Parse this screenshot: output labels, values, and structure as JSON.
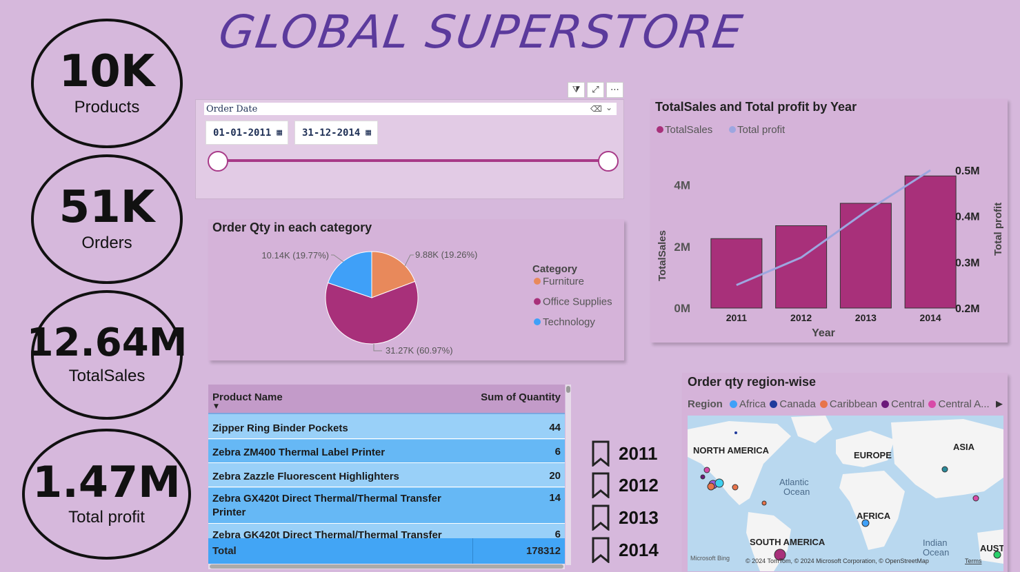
{
  "title": "GLOBAL SUPERSTORE",
  "kpis": [
    {
      "value": "10K",
      "label": "Products"
    },
    {
      "value": "51K",
      "label": "Orders"
    },
    {
      "value": "12.64M",
      "label": "TotalSales"
    },
    {
      "value": "1.47M",
      "label": "Total profit"
    }
  ],
  "slicer": {
    "label": "Order Date",
    "start_date": "01-01-2011",
    "end_date": "31-12-2014",
    "range_fraction": [
      0,
      1
    ]
  },
  "pie": {
    "title": "Order Qty in each category",
    "legend_title": "Category",
    "chart_data": {
      "type": "pie",
      "categories": [
        "Furniture",
        "Office Supplies",
        "Technology"
      ],
      "values": [
        9.88,
        31.27,
        10.14
      ],
      "labels": [
        "9.88K (19.26%)",
        "31.27K (60.97%)",
        "10.14K (19.77%)"
      ],
      "colors": [
        "#e8895b",
        "#a8307a",
        "#3fa0f8"
      ]
    }
  },
  "combo": {
    "title": "TotalSales and Total profit by Year",
    "chart_data": {
      "type": "bar",
      "categories": [
        "2011",
        "2012",
        "2013",
        "2014"
      ],
      "series": [
        {
          "name": "TotalSales",
          "values": [
            2.26,
            2.68,
            3.41,
            4.3
          ],
          "color": "#a8307a",
          "axis": "left"
        },
        {
          "name": "Total profit",
          "values": [
            0.25,
            0.31,
            0.41,
            0.5
          ],
          "color": "#9da6e0",
          "axis": "right",
          "type": "line"
        }
      ],
      "xlabel": "Year",
      "ylabel": "TotalSales",
      "y2label": "Total profit",
      "left_ticks": [
        "0M",
        "2M",
        "4M"
      ],
      "left_range": [
        0,
        4.8
      ],
      "right_ticks": [
        "0.2M",
        "0.3M",
        "0.4M",
        "0.5M"
      ],
      "right_range": [
        0.2,
        0.5
      ]
    }
  },
  "table": {
    "headers": [
      "Product Name",
      "Sum of Quantity"
    ],
    "rows": [
      {
        "name": "Zipper Ring Binder Pockets",
        "qty": "44"
      },
      {
        "name": "Zebra ZM400 Thermal Label Printer",
        "qty": "6"
      },
      {
        "name": "Zebra Zazzle Fluorescent Highlighters",
        "qty": "20"
      },
      {
        "name": "Zebra GX420t Direct Thermal/Thermal Transfer Printer",
        "qty": "14"
      },
      {
        "name": "Zebra GK420t Direct Thermal/Thermal Transfer",
        "qty": "6"
      }
    ],
    "total_label": "Total",
    "total_value": "178312"
  },
  "bookmarks": [
    "2011",
    "2012",
    "2013",
    "2014"
  ],
  "map": {
    "title": "Order qty region-wise",
    "legend_title": "Region",
    "legend": [
      {
        "name": "Africa",
        "color": "#3fa0f8"
      },
      {
        "name": "Canada",
        "color": "#1f3a9c"
      },
      {
        "name": "Caribbean",
        "color": "#e8744b"
      },
      {
        "name": "Central",
        "color": "#6b1a7a"
      },
      {
        "name": "Central A...",
        "color": "#d84aa8"
      }
    ],
    "labels": {
      "north_america": "NORTH AMERICA",
      "europe": "EUROPE",
      "asia": "ASIA",
      "atlantic": "Atlantic",
      "ocean": "Ocean",
      "africa": "AFRICA",
      "south_america": "SOUTH AMERICA",
      "indian": "Indian",
      "indian_ocean": "Ocean",
      "aust": "AUST"
    },
    "attribution": "© 2024 TomTom, © 2024 Microsoft Corporation, © OpenStreetMap",
    "terms": "Terms",
    "bing": "Microsoft Bing"
  }
}
